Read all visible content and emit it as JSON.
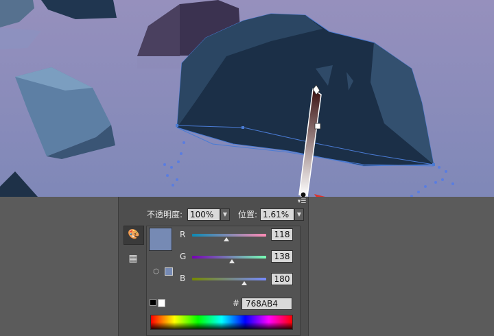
{
  "canvas": {
    "colors": {
      "sky_top": "#8f8fb8",
      "sky_bottom": "#7f86b6",
      "rock_main": "#1e3148",
      "rock_dark": "#0f2032",
      "rock_purple": "#3e3550",
      "rock_left_light": "#6a8cb0",
      "selection_blue": "#4a7bd4",
      "annotation_red": "#e0322a"
    },
    "gradient_stop_position": "1.61%"
  },
  "panel": {
    "opacity_label": "不透明度:",
    "opacity_value": "100%",
    "position_label": "位置:",
    "position_value": "1.61%",
    "menu_icon": "panel-menu-icon",
    "tools": {
      "palette_icon": "color-palette-icon",
      "swatch_grid_icon": "swatch-grid-icon"
    },
    "color": {
      "hex_label": "#",
      "hex_value": "768AB4",
      "preview_color": "#768AB4",
      "channels": [
        {
          "label": "R",
          "value": "118",
          "level": 0.463
        },
        {
          "label": "G",
          "value": "138",
          "level": 0.541
        },
        {
          "label": "B",
          "value": "180",
          "level": 0.706
        }
      ]
    }
  }
}
